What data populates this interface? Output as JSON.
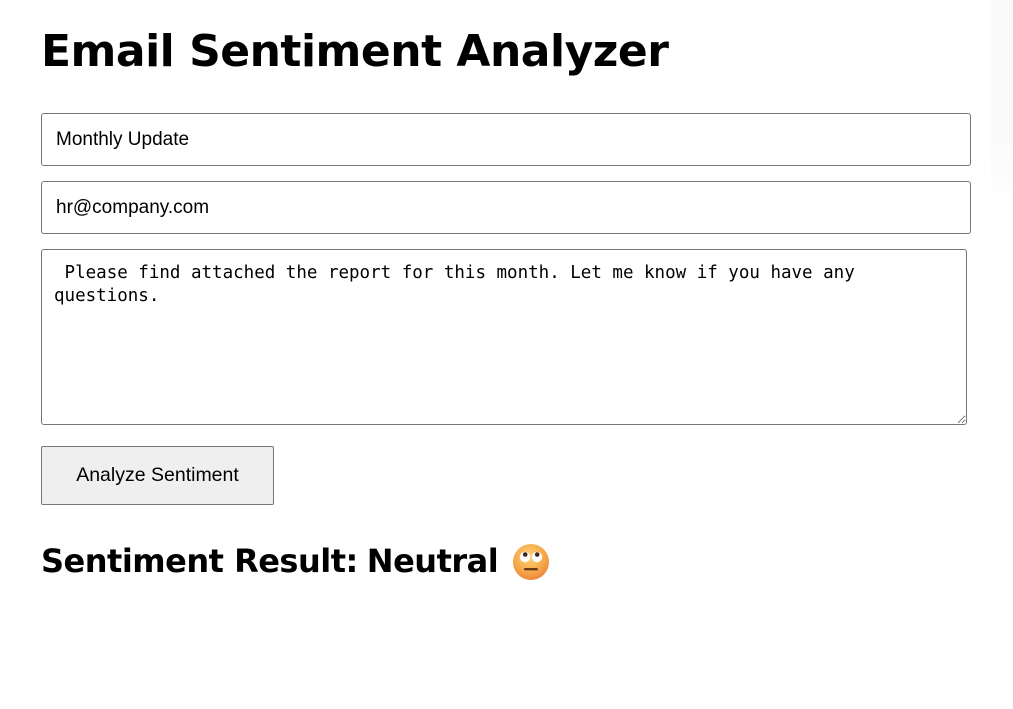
{
  "page": {
    "title": "Email Sentiment Analyzer"
  },
  "form": {
    "subject_value": "Monthly Update",
    "sender_value": "hr@company.com",
    "body_value": " Please find attached the report for this month. Let me know if you have any questions.",
    "analyze_label": "Analyze Sentiment"
  },
  "result": {
    "prefix": "Sentiment Result:",
    "value": "Neutral",
    "icon": "neutral-face-emoji-icon"
  },
  "colors": {
    "border": "#767676",
    "button_bg": "#efefef",
    "emoji_face": "#f5a442"
  }
}
